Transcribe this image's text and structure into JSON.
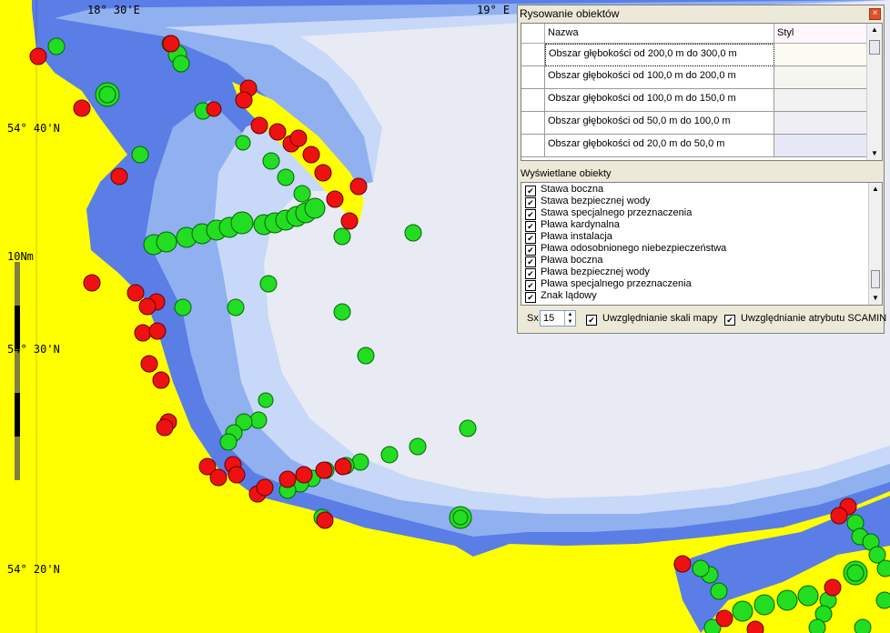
{
  "map": {
    "coord_labels": {
      "lon1": "18° 30'E",
      "lon2": "19° E",
      "lat1": "54° 40'N",
      "lat2": "54° 30'N",
      "lat3": "54° 20'N"
    },
    "scale_label": "10Nm",
    "colors": {
      "land": "#ffff00",
      "deep": "#5a7ee6",
      "mid": "#90b0f0",
      "light": "#c8d8f8",
      "offshore": "#e8eaf4",
      "safe_buoy": "#00ee00",
      "danger_buoy": "#ee0000"
    }
  },
  "dialog": {
    "title": "Rysowanie obiektów",
    "close_icon": "close-icon",
    "grid": {
      "col_name": "Nazwa",
      "col_style": "Styl",
      "rows": [
        {
          "name": "Obszar głębokości od 200,0 m do 300,0 m",
          "color": "#fbfbf2"
        },
        {
          "name": "Obszar głębokości od 100,0 m do 200,0 m",
          "color": "#f6f6f0"
        },
        {
          "name": "Obszar głębokości od 100,0 m do 150,0 m",
          "color": "#f2f2f2"
        },
        {
          "name": "Obszar głębokości od 50,0 m do 100,0 m",
          "color": "#eeeef4"
        },
        {
          "name": "Obszar głębokości od 20,0 m do 50,0 m",
          "color": "#e6e8f8"
        }
      ]
    },
    "list_label": "Wyświetlane obiekty",
    "list_items": [
      "Stawa boczna",
      "Stawa bezpiecznej wody",
      "Stawa specjalnego przeznaczenia",
      "Pława kardynalna",
      "Pława instalacja",
      "Pława odosobnionego niebezpieczeństwa",
      "Pława boczna",
      "Pława bezpiecznej wody",
      "Pława specjalnego przeznaczenia",
      "Znak lądowy"
    ],
    "sx_label": "Sx",
    "sx_value": "15",
    "scale_check_label": "Uwzględnianie skali mapy",
    "scamin_check_label": "Uwzględnianie atrybutu SCAMIN"
  }
}
